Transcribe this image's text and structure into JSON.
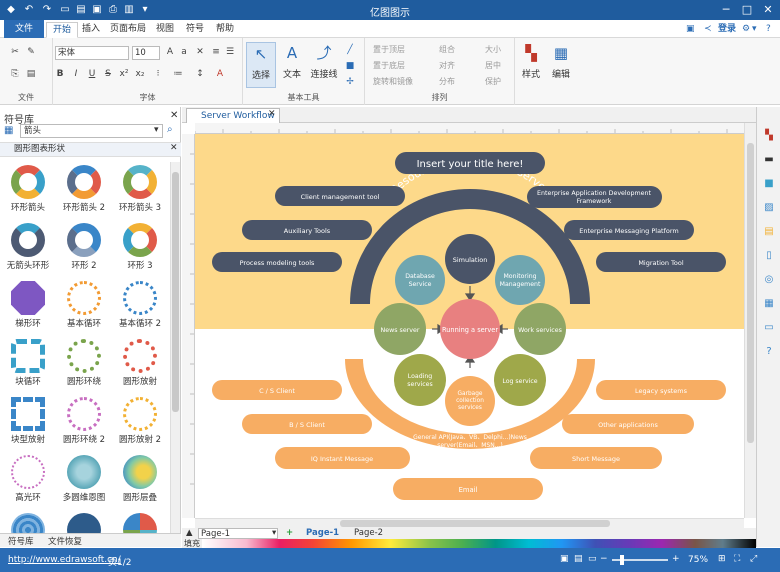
{
  "app": {
    "title": "亿图图示"
  },
  "tabs": {
    "file": "文件",
    "home": "开始",
    "insert": "插入",
    "page_layout": "页面布局",
    "view": "视图",
    "symbol": "符号",
    "help": "帮助",
    "login": "登录"
  },
  "ribbon": {
    "font_name": "宋体",
    "font_size": "10",
    "groups": {
      "file": "文件",
      "font": "字体",
      "basic_tools": "基本工具",
      "arrange": "排列"
    },
    "select": "选择",
    "text": "文本",
    "connector": "连接线",
    "arrange_items": [
      "置于顶层",
      "组合",
      "大小",
      "置于底层",
      "对齐",
      "居中",
      "旋转和镜像",
      "分布",
      "保护"
    ],
    "style": "样式",
    "edit": "编辑"
  },
  "library": {
    "title": "符号库",
    "search_value": "箭头",
    "category": "圆形图表形状",
    "shapes": [
      "环形箭头",
      "环形箭头 2",
      "环形箭头 3",
      "无箭头环形",
      "环形 2",
      "环形 3",
      "梯形环",
      "基本循环",
      "基本循环 2",
      "块循环",
      "圆形环绕",
      "圆形放射",
      "块型放射",
      "圆形环绕 2",
      "圆形放射 2",
      "高光环",
      "多圆维恩图",
      "圆形层叠",
      "",
      ""
    ],
    "bottom_tabs": [
      "符号库",
      "文件恢复"
    ]
  },
  "doc": {
    "tab": "Server Workflow"
  },
  "diagram": {
    "title": "Insert your title here!",
    "arc_text": "Resource management server",
    "center": "Running a server",
    "nodes": {
      "simulation": "Simulation",
      "database": [
        "Database",
        "Service"
      ],
      "monitoring": [
        "Monitoring",
        "Management"
      ],
      "news": "News server",
      "work": "Work services",
      "loading": [
        "Loading",
        "services"
      ],
      "log": "Log service",
      "garbage": [
        "Garbage",
        "collection",
        "services"
      ]
    },
    "left_top_pills": [
      "Client management tool",
      "Auxiliary Tools",
      "Process modeling tools"
    ],
    "right_top_pills": [
      [
        "Enterprise Application Development",
        "Framework"
      ],
      "Enterprise Messaging Platform",
      "Migration Tool"
    ],
    "left_bottom_pills": [
      "C / S Client",
      "B / S Client",
      "IQ Instant Message"
    ],
    "right_bottom_pills": [
      "Legacy systems",
      "Other applications",
      "Short Message"
    ],
    "bottom_pill": "Email",
    "general_api": [
      "General API(Java、VB、Delphi...)News",
      "server(Email、MSN...)"
    ]
  },
  "pages": {
    "tab1": "Page-1",
    "active": "Page-1",
    "tab2": "Page-2",
    "fill_label": "填充"
  },
  "status": {
    "url": "http://www.edrawsoft.cn/",
    "page": "页1/2",
    "zoom": "75%"
  },
  "colors": {
    "accent": "#2b6cb5",
    "canvas_top": "#fdd98a",
    "dark_pill": "#4a5468",
    "orange": "#f7ad63",
    "teal": "#6fa6b0",
    "green": "#8fa665",
    "olive": "#9fa84a",
    "pink": "#e88080"
  }
}
